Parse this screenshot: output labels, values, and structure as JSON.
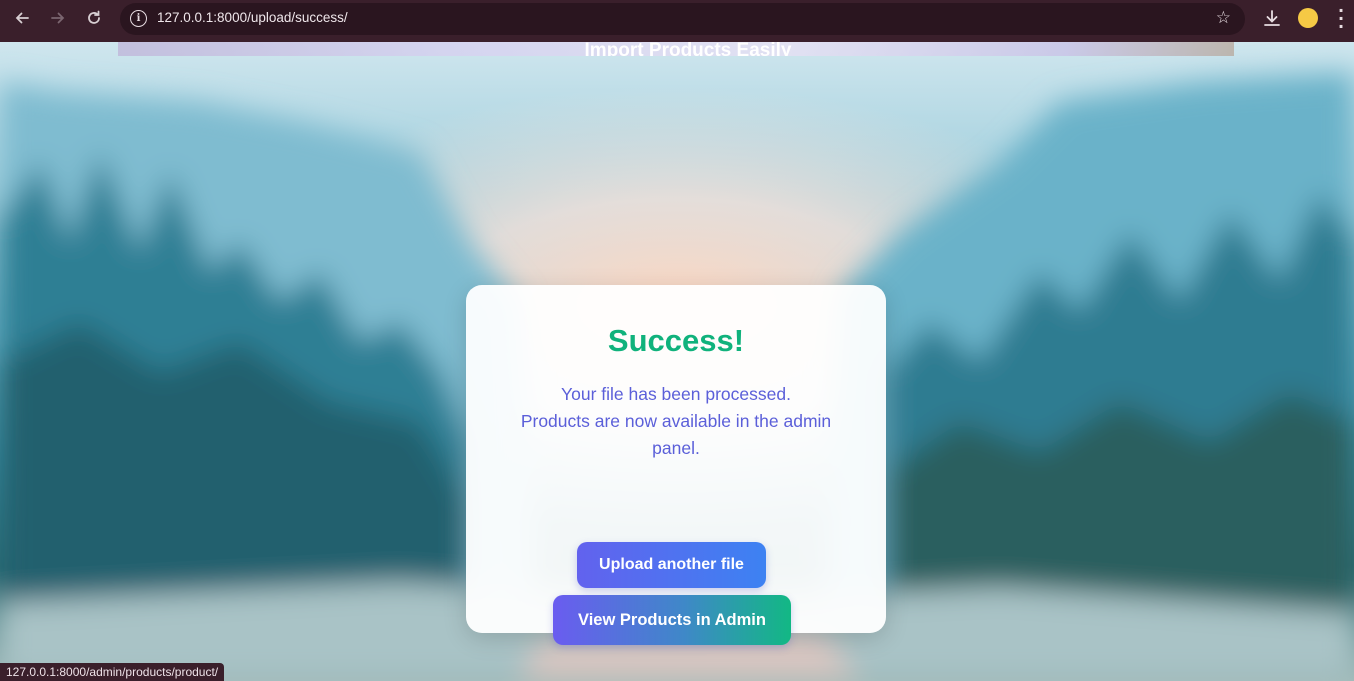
{
  "browser": {
    "url": "127.0.0.1:8000/upload/success/",
    "icons": [
      "back-arrow-icon",
      "forward-arrow-icon",
      "reload-icon",
      "info-icon",
      "star-icon",
      "download-icon",
      "profile-avatar",
      "kebab-menu-icon"
    ],
    "status_link": "127.0.0.1:8000/admin/products/product/"
  },
  "page": {
    "banner_title": "Import Products Easily"
  },
  "card": {
    "title": "Success!",
    "message_line1": "Your file has been processed.",
    "message_line2": "Products are now available in the admin panel.",
    "upload_button": "Upload another file",
    "admin_button": "View Products in Admin"
  },
  "colors": {
    "success": "#10b27c",
    "message": "#5b5fd9",
    "chrome": "#3a1f2b",
    "button_start": "#6262ee",
    "button_end": "#12b884"
  }
}
